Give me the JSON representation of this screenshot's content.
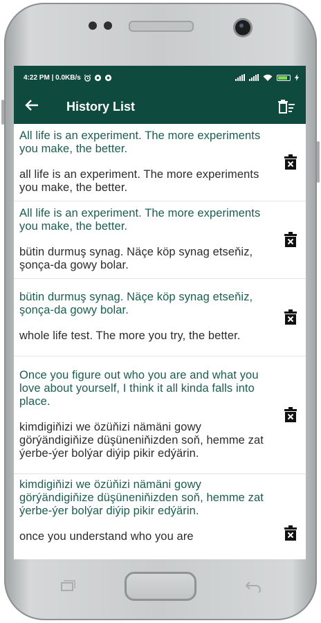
{
  "status": {
    "time_info": "4:22 PM | 0.0KB/s",
    "icons": [
      "alarm-icon",
      "settings-icon",
      "settings-icon"
    ]
  },
  "toolbar": {
    "title": "History List"
  },
  "history": [
    {
      "source": "All life is an experiment. The more experiments you make, the better.",
      "translation": "all life is an experiment. The more experiments you make, the better."
    },
    {
      "source": "All life is an experiment. The more experiments you make, the better.",
      "translation": "bütin durmuş synag. Näçe köp synag etseňiz, şonça-da gowy bolar."
    },
    {
      "source": "bütin durmuş synag. Näçe köp synag etseňiz, şonça-da gowy bolar.",
      "translation": "whole life test. The more you try, the better."
    },
    {
      "source": "Once you figure out who you are and what you love about yourself, I think it all kinda falls into place.",
      "translation": "kimdigiňizi we özüňizi nämäni gowy görýändigiňize düşüneniňizden soň, hemme zat ýerbe-ýer bolýar diýip pikir edýärin."
    },
    {
      "source": "kimdigiňizi we özüňizi nämäni gowy görýändigiňize düşüneniňizden soň, hemme zat ýerbe-ýer bolýar diýip pikir edýärin.",
      "translation": "once you understand who you are"
    }
  ],
  "colors": {
    "primary": "#0e4a3d",
    "source_text": "#1a5e4d",
    "translation_text": "#2b2b2b"
  }
}
